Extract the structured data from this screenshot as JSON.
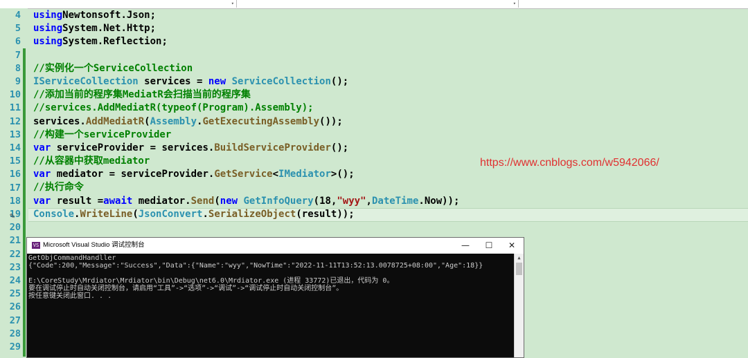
{
  "code": {
    "line_numbers": [
      "4",
      "5",
      "6",
      "7",
      "8",
      "9",
      "10",
      "11",
      "12",
      "13",
      "14",
      "15",
      "16",
      "17",
      "18",
      "19",
      "20",
      "21",
      "22",
      "23",
      "24",
      "25",
      "26",
      "27",
      "28",
      "29"
    ],
    "lines": [
      [
        [
          "kw",
          "using"
        ],
        [
          "",
          "Newtonsoft.Json;"
        ]
      ],
      [
        [
          "kw",
          "using"
        ],
        [
          "",
          "System.Net.Http;"
        ]
      ],
      [
        [
          "kw",
          "using"
        ],
        [
          "",
          "System.Reflection;"
        ]
      ],
      [],
      [
        [
          "cm",
          "//实例化一个ServiceCollection"
        ]
      ],
      [
        [
          "ty",
          "IServiceCollection"
        ],
        [
          "",
          " services = "
        ],
        [
          "kw",
          "new"
        ],
        [
          "",
          " "
        ],
        [
          "ty",
          "ServiceCollection"
        ],
        [
          "",
          "();"
        ]
      ],
      [
        [
          "cm",
          "//添加当前的程序集MediatR会扫描当前的程序集"
        ]
      ],
      [
        [
          "cm",
          "//services.AddMediatR(typeof(Program).Assembly);"
        ]
      ],
      [
        [
          "",
          "services."
        ],
        [
          "fn",
          "AddMediatR"
        ],
        [
          "",
          "("
        ],
        [
          "ty",
          "Assembly"
        ],
        [
          "",
          "."
        ],
        [
          "fn",
          "GetExecutingAssembly"
        ],
        [
          "",
          "());"
        ]
      ],
      [
        [
          "cm",
          "//构建一个serviceProvider"
        ]
      ],
      [
        [
          "kw",
          "var"
        ],
        [
          "",
          " serviceProvider = services."
        ],
        [
          "fn",
          "BuildServiceProvider"
        ],
        [
          "",
          "();"
        ]
      ],
      [
        [
          "cm",
          "//从容器中获取mediator"
        ]
      ],
      [
        [
          "kw",
          "var"
        ],
        [
          "",
          " mediator = serviceProvider."
        ],
        [
          "fn",
          "GetService"
        ],
        [
          "",
          "<"
        ],
        [
          "ty",
          "IMediator"
        ],
        [
          "",
          ">();"
        ]
      ],
      [
        [
          "cm",
          "//执行命令"
        ]
      ],
      [
        [
          "kw",
          "var"
        ],
        [
          "",
          " result ="
        ],
        [
          "kw",
          "await"
        ],
        [
          "",
          " mediator."
        ],
        [
          "fn",
          "Send"
        ],
        [
          "",
          "("
        ],
        [
          "kw",
          "new"
        ],
        [
          "",
          " "
        ],
        [
          "ty",
          "GetInfoQuery"
        ],
        [
          "",
          "(18,"
        ],
        [
          "st",
          "\"wyy\""
        ],
        [
          "",
          ","
        ],
        [
          "ty",
          "DateTime"
        ],
        [
          "",
          ".Now));"
        ]
      ],
      [
        [
          "ty",
          "Console"
        ],
        [
          "",
          "."
        ],
        [
          "fn",
          "WriteLine"
        ],
        [
          "",
          "("
        ],
        [
          "ty",
          "JsonConvert"
        ],
        [
          "",
          "."
        ],
        [
          "fn",
          "SerializeObject"
        ],
        [
          "",
          "(result));"
        ]
      ]
    ]
  },
  "watermark_url": "https://www.cnblogs.com/w5942066/",
  "console": {
    "title": "Microsoft Visual Studio 调试控制台",
    "minimize": "—",
    "maximize": "☐",
    "close": "✕",
    "output": [
      "GetObjCommandHandller",
      "{\"Code\":200,\"Message\":\"Success\",\"Data\":{\"Name\":\"wyy\",\"NowTime\":\"2022-11-11T13:52:13.0078725+08:00\",\"Age\":18}}",
      "",
      "E:\\CoreStudy\\Mrdiator\\Mrdiator\\bin\\Debug\\net6.0\\Mrdiator.exe (进程 33772)已退出，代码为 0。",
      "要在调试停止时自动关闭控制台，请启用“工具”->“选项”->“调试”->“调试停止时自动关闭控制台”。",
      "按任意键关闭此窗口. . ."
    ]
  }
}
